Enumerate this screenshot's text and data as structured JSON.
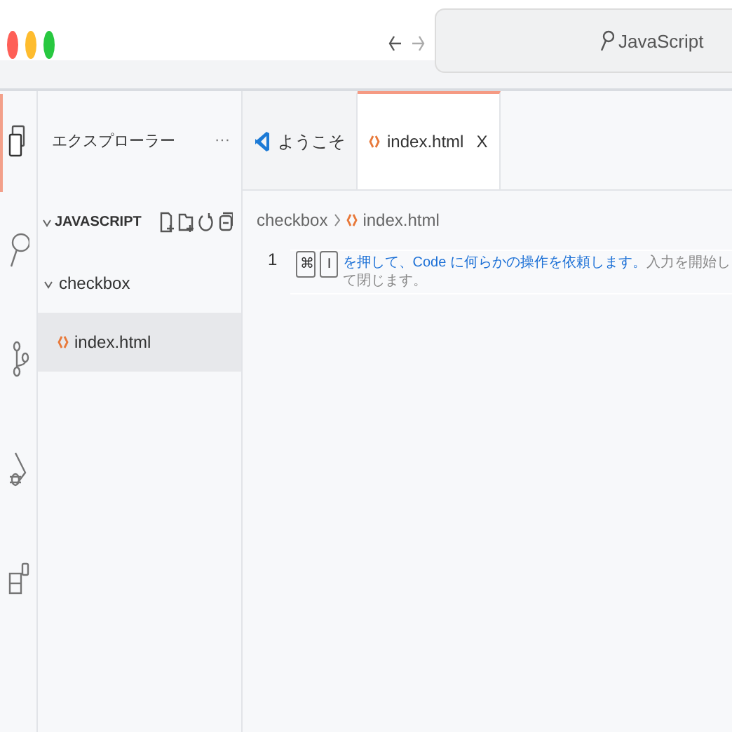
{
  "browser": {
    "search": {
      "value": "JavaScript"
    }
  },
  "activity_bar": [
    {
      "kind": "files",
      "selected": true
    },
    {
      "kind": "search",
      "selected": false
    },
    {
      "kind": "branch",
      "selected": false
    },
    {
      "kind": "debug",
      "selected": false
    },
    {
      "kind": "extensions",
      "selected": false
    }
  ],
  "sidebar": {
    "title": "エクスプローラー",
    "more": "···",
    "section": {
      "title": "JAVASCRIPT",
      "expanded": true
    },
    "tree": [
      {
        "label": "checkbox",
        "kind": "folder",
        "expanded": true,
        "selected": false,
        "children": [
          {
            "label": "index.html",
            "kind": "html",
            "selected": true
          }
        ]
      }
    ]
  },
  "tabs": [
    {
      "kind": "welcome",
      "label": "ようこそ",
      "selected": false
    },
    {
      "kind": "html",
      "label": "index.html",
      "selected": true,
      "close": "X"
    }
  ],
  "breadcrumb": [
    {
      "kind": "folder",
      "label": "checkbox"
    },
    {
      "kind": "html",
      "label": "index.html"
    }
  ],
  "editor": {
    "lines": [
      {
        "number": "1",
        "keys": [
          "⌘",
          "I"
        ],
        "hint": "を押して、Code に何らかの操作を依頼します。",
        "hint_rest": "入力を開始して閉じます。"
      }
    ]
  }
}
